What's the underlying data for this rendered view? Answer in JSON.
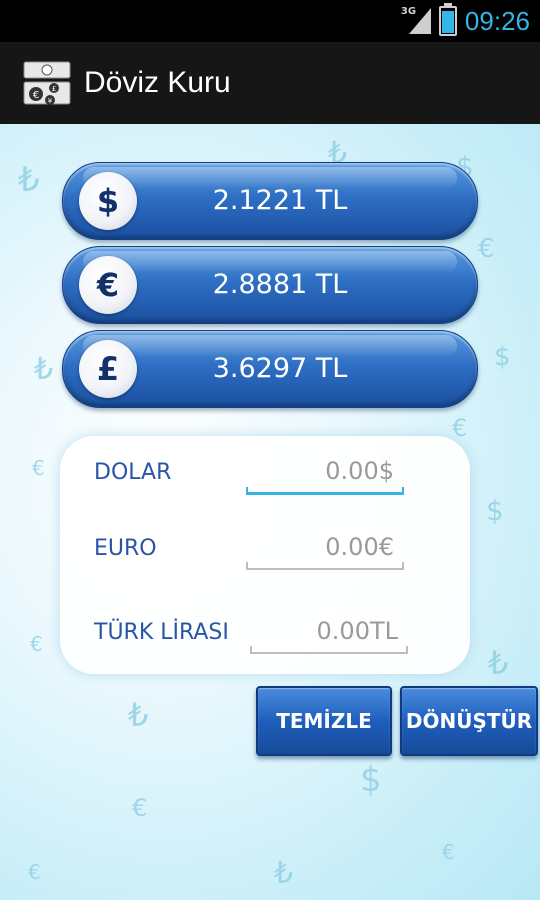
{
  "status_bar": {
    "network": "3G",
    "time": "09:26"
  },
  "action_bar": {
    "title": "Döviz Kuru",
    "icon": "currency-exchange-icon"
  },
  "rates": [
    {
      "symbol": "$",
      "value": "2.1221 TL"
    },
    {
      "symbol": "€",
      "value": "2.8881 TL"
    },
    {
      "symbol": "£",
      "value": "3.6297 TL"
    }
  ],
  "converter": {
    "dolar_label": "DOLAR",
    "dolar_value": "0.00$",
    "euro_label": "EURO",
    "euro_value": "0.00€",
    "try_label": "TÜRK LİRASI",
    "try_value": "0.00TL"
  },
  "buttons": {
    "clear": "TEMİZLE",
    "convert": "DÖNÜŞTÜR"
  },
  "colors": {
    "accent": "#33b5e5",
    "pill": "#2e6fc4",
    "label": "#2a55a7"
  }
}
